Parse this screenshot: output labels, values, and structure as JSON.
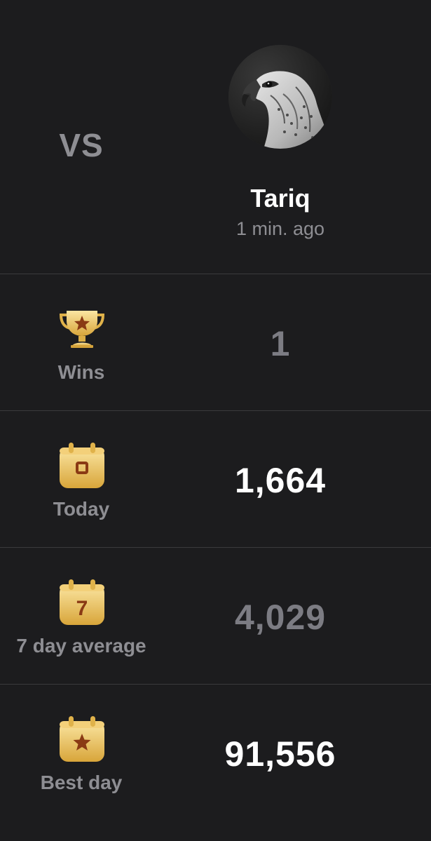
{
  "header": {
    "vs_label": "VS",
    "opponent": {
      "name": "Tariq",
      "last_seen": "1 min. ago",
      "avatar_icon": "falcon-avatar"
    }
  },
  "stats": [
    {
      "icon": "trophy-star-icon",
      "label": "Wins",
      "value": "1",
      "emphasis": "dim"
    },
    {
      "icon": "calendar-today-icon",
      "icon_glyph": "0",
      "label": "Today",
      "value": "1,664",
      "emphasis": "bright"
    },
    {
      "icon": "calendar-week-icon",
      "icon_glyph": "7",
      "label": "7 day average",
      "value": "4,029",
      "emphasis": "dim"
    },
    {
      "icon": "calendar-star-icon",
      "label": "Best day",
      "value": "91,556",
      "emphasis": "bright"
    }
  ],
  "colors": {
    "background": "#1c1c1e",
    "divider": "#3a3a3c",
    "muted_text": "#8e8e93",
    "gold_light": "#f7dc85",
    "gold_dark": "#d9a93d",
    "icon_brown": "#8a3a14"
  }
}
